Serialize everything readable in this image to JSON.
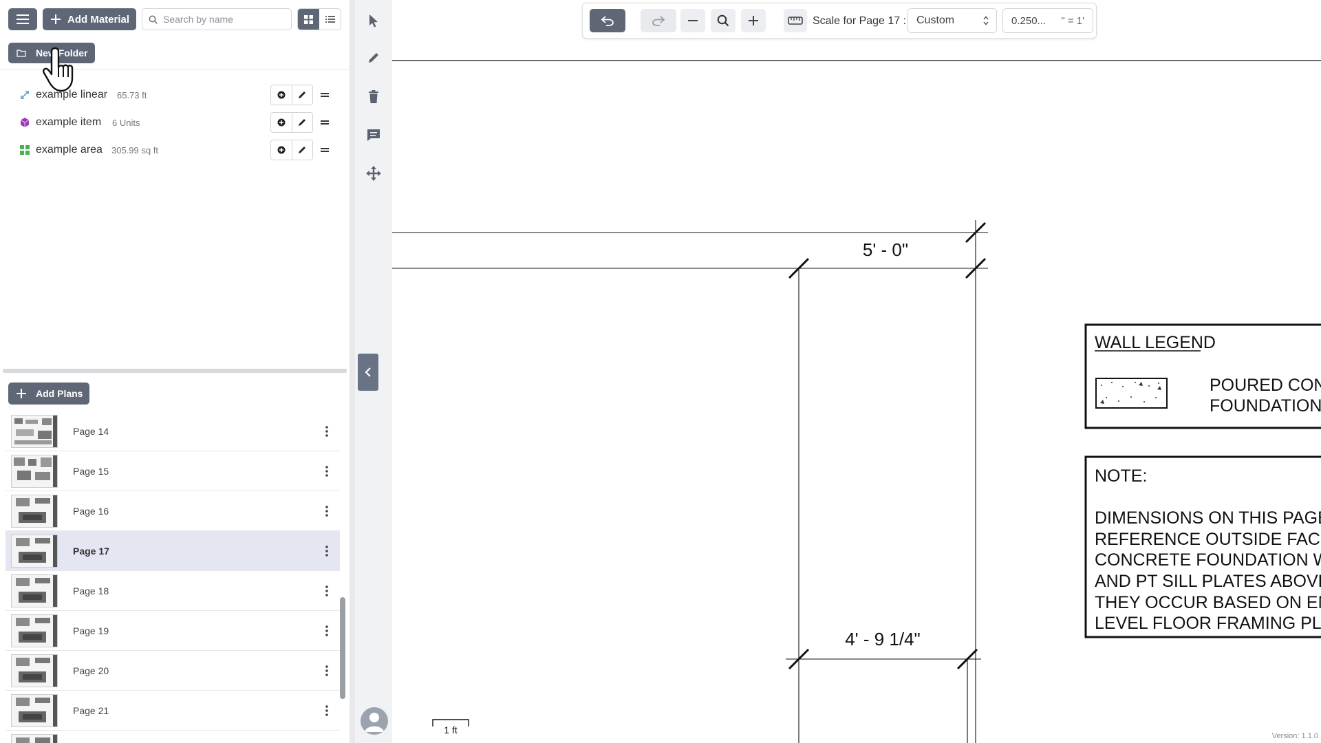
{
  "toolbar_left": {
    "add_material_label": "Add Material",
    "search_placeholder": "Search by name",
    "new_folder_label": "New Folder"
  },
  "materials": [
    {
      "name": "example linear",
      "quantity": "65.73 ft",
      "icon": "linear-measure-icon",
      "color": "#4aa3d8"
    },
    {
      "name": "example item",
      "quantity": "6 Units",
      "icon": "cube-icon",
      "color": "#9b3bb5"
    },
    {
      "name": "example area",
      "quantity": "305.99 sq ft",
      "icon": "area-grid-icon",
      "color": "#4caf50"
    }
  ],
  "plans": {
    "add_plans_label": "Add Plans",
    "pages": [
      {
        "label": "Page 14",
        "selected": false
      },
      {
        "label": "Page 15",
        "selected": false
      },
      {
        "label": "Page 16",
        "selected": false
      },
      {
        "label": "Page 17",
        "selected": true
      },
      {
        "label": "Page 18",
        "selected": false
      },
      {
        "label": "Page 19",
        "selected": false
      },
      {
        "label": "Page 20",
        "selected": false
      },
      {
        "label": "Page 21",
        "selected": false
      },
      {
        "label": "",
        "selected": false
      }
    ]
  },
  "top_toolbar": {
    "scale_label": "Scale for Page 17 :",
    "scale_option": "Custom",
    "scale_value": "0.250...",
    "scale_unit": "\" = 1'"
  },
  "drawing": {
    "dim_top": "5' - 0\"",
    "dim_bottom": "4' - 9 1/4\"",
    "wall_legend_title": "WALL LEGEND",
    "wall_legend_line1": "POURED CONC",
    "wall_legend_line2": "FOUNDATION W",
    "note_title": "NOTE:",
    "note_lines": [
      "DIMENSIONS ON THIS PAGE",
      "REFERENCE OUTSIDE FACES O",
      "CONCRETE FOUNDATION WALL",
      "AND PT SILL PLATES ABOVE W",
      "THEY OCCUR BASED ON ENTR",
      "LEVEL FLOOR FRAMING PLAN."
    ],
    "scale_bar_label": "1 ft"
  },
  "footer": {
    "version": "Version: 1.1.0"
  },
  "colors": {
    "dark_button": "#5f6776",
    "selected_row": "#e4e7f1",
    "tool_rail": "#f1f2f4"
  }
}
